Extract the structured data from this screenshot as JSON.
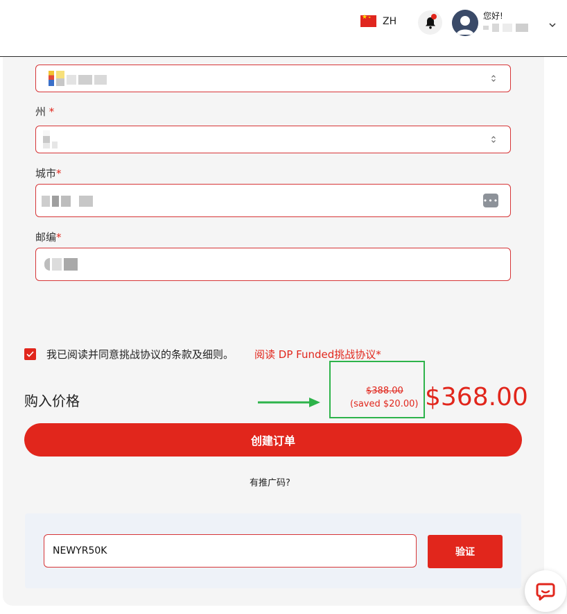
{
  "header": {
    "lang_code": "ZH",
    "greeting": "您好!"
  },
  "form": {
    "state_label": "州",
    "city_label": "城市",
    "zip_label": "邮编",
    "required_mark": "*"
  },
  "agreement": {
    "checked": true,
    "text": "我已阅读并同意挑战协议的条款及细则。",
    "link": "阅读 DP Funded挑战协议*"
  },
  "price": {
    "label": "购入价格",
    "old_price": "$388.00",
    "saved": "(saved $20.00)",
    "new_price": "$368.00"
  },
  "actions": {
    "create_order": "创建订单",
    "promo_question": "有推广码?",
    "promo_value": "NEWYR50K",
    "verify": "验证"
  },
  "colors": {
    "accent": "#e1261c",
    "highlight": "#2db34a"
  },
  "icons": [
    "china-flag-icon",
    "bell-icon",
    "chevron-down-icon",
    "updown-chevron-icon",
    "keyboard-icon",
    "check-icon",
    "arrow-right-icon",
    "chat-icon"
  ]
}
